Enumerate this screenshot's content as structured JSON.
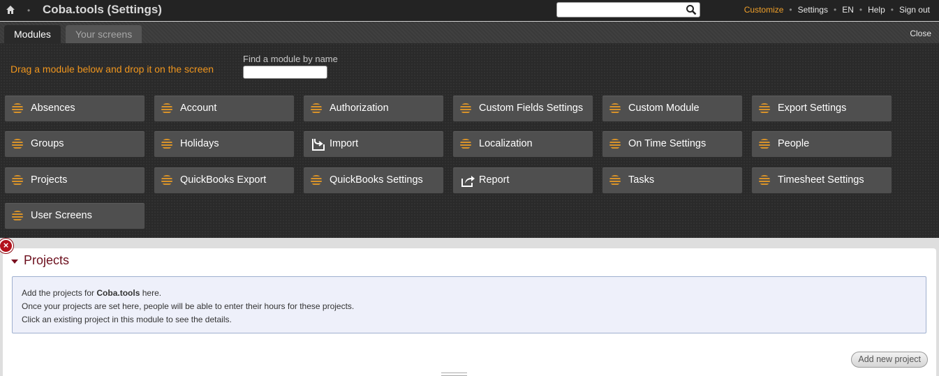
{
  "app": {
    "title": "Coba.tools (Settings)"
  },
  "topnav": {
    "search_placeholder": "",
    "links": {
      "customize": "Customize",
      "settings": "Settings",
      "lang": "EN",
      "help": "Help",
      "signout": "Sign out"
    }
  },
  "tabs": {
    "modules": "Modules",
    "screens": "Your screens",
    "close": "Close"
  },
  "panel": {
    "drag_hint": "Drag a module below and drop it on the screen",
    "find_label": "Find a module by name",
    "find_value": ""
  },
  "modules": [
    {
      "label": "Absences",
      "icon": "stripes-icon"
    },
    {
      "label": "Account",
      "icon": "stripes-icon"
    },
    {
      "label": "Authorization",
      "icon": "stripes-icon"
    },
    {
      "label": "Custom Fields Settings",
      "icon": "stripes-icon"
    },
    {
      "label": "Custom Module",
      "icon": "stripes-icon"
    },
    {
      "label": "Export Settings",
      "icon": "stripes-icon"
    },
    {
      "label": "Groups",
      "icon": "stripes-icon"
    },
    {
      "label": "Holidays",
      "icon": "stripes-icon"
    },
    {
      "label": "Import",
      "icon": "import-icon"
    },
    {
      "label": "Localization",
      "icon": "stripes-icon"
    },
    {
      "label": "On Time Settings",
      "icon": "stripes-icon"
    },
    {
      "label": "People",
      "icon": "stripes-icon"
    },
    {
      "label": "Projects",
      "icon": "stripes-icon"
    },
    {
      "label": "QuickBooks Export",
      "icon": "stripes-icon"
    },
    {
      "label": "QuickBooks Settings",
      "icon": "stripes-icon"
    },
    {
      "label": "Report",
      "icon": "report-icon"
    },
    {
      "label": "Tasks",
      "icon": "stripes-icon"
    },
    {
      "label": "Timesheet Settings",
      "icon": "stripes-icon"
    },
    {
      "label": "User Screens",
      "icon": "stripes-icon"
    }
  ],
  "projects_card": {
    "title": "Projects",
    "line1_prefix": "Add the projects for ",
    "line1_company": "Coba.tools",
    "line1_suffix": " here.",
    "line2": "Once your projects are set here, people will be able to enter their hours for these projects.",
    "line3": "Click an existing project in this module to see the details.",
    "add_button": "Add new project"
  },
  "colors": {
    "accent": "#f0961e",
    "module_bg": "#4f4f4f",
    "card_title": "#6c0f1d",
    "remove_badge": "#b3121c"
  }
}
